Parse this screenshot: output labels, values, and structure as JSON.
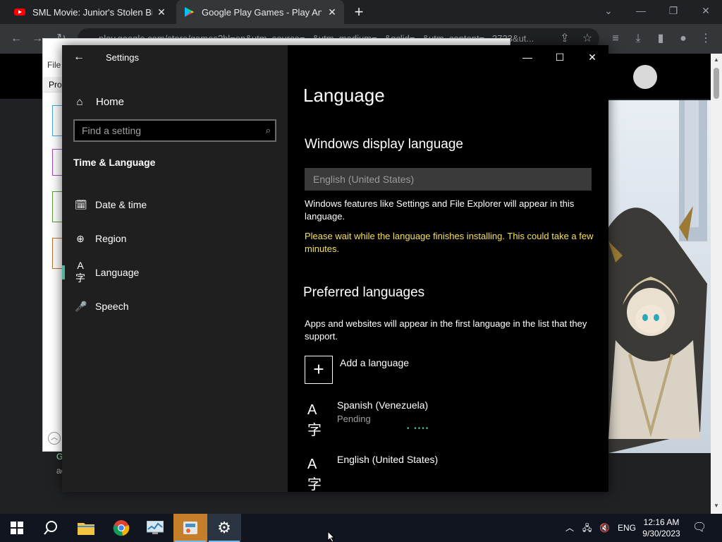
{
  "browser": {
    "tabs": [
      {
        "title": "SML Movie: Junior's Stolen Birthday"
      },
      {
        "title": "Google Play Games - Play Android Games on PC"
      }
    ],
    "new_tab_label": "+",
    "url": "play.google.com/store/games?hl=en&utm_source=...&utm_medium=...&gclid=...&utm_content=...3723&ut..."
  },
  "background_window": {
    "menu": "File",
    "tab": "Proc",
    "frag1": "G",
    "frag2": "ac"
  },
  "settings": {
    "app_title": "Settings",
    "home_label": "Home",
    "search_placeholder": "Find a setting",
    "section_title": "Time & Language",
    "nav_items": [
      {
        "label": "Date & time",
        "icon": "calendar-clock-icon"
      },
      {
        "label": "Region",
        "icon": "globe-icon"
      },
      {
        "label": "Language",
        "icon": "language-icon"
      },
      {
        "label": "Speech",
        "icon": "microphone-icon"
      }
    ],
    "main": {
      "page_title": "Language",
      "display_heading": "Windows display language",
      "display_value": "English (United States)",
      "display_desc": "Windows features like Settings and File Explorer will appear in this language.",
      "warning": "Please wait while the language finishes installing. This could take a few minutes.",
      "preferred_heading": "Preferred languages",
      "preferred_desc": "Apps and websites will appear in the first language in the list that they support.",
      "add_label": "Add a language",
      "languages": [
        {
          "name": "Spanish (Venezuela)",
          "status": "Pending"
        },
        {
          "name": "English (United States)",
          "status": ""
        }
      ]
    }
  },
  "taskbar": {
    "tray_lang": "ENG",
    "time": "12:16 AM",
    "date": "9/30/2023"
  },
  "colors": {
    "accent": "#4fb29a",
    "warning": "#f5e05a"
  }
}
